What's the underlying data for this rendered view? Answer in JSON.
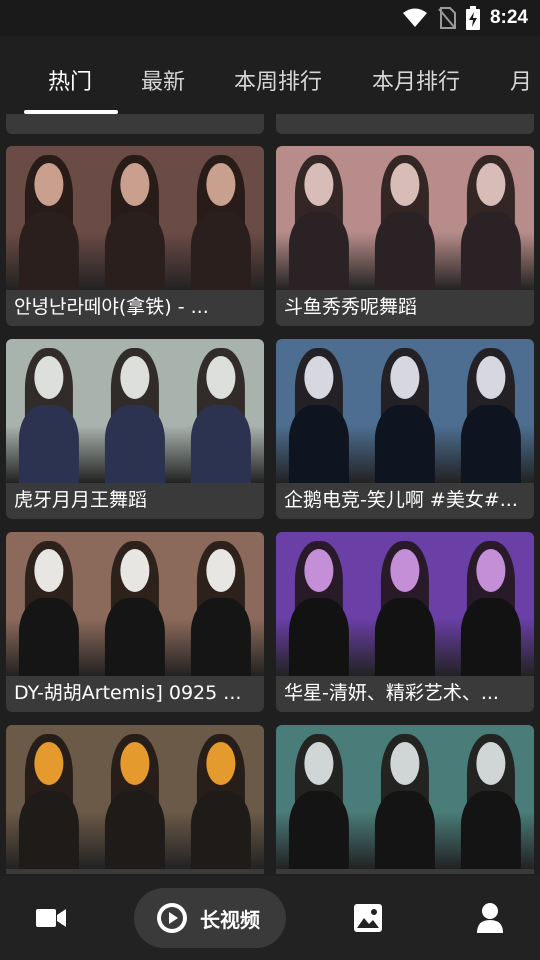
{
  "status": {
    "time": "8:24"
  },
  "tabs": [
    {
      "label": "热门",
      "active": true
    },
    {
      "label": "最新"
    },
    {
      "label": "本周排行"
    },
    {
      "label": "本月排行"
    },
    {
      "label": "月"
    }
  ],
  "cards": [
    {
      "title": "안녕난라떼야(拿铁) - ...",
      "colors": [
        "#6b4b45",
        "#c99f8e",
        "#2b1f1d"
      ]
    },
    {
      "title": "斗鱼秀秀呢舞蹈",
      "colors": [
        "#b78c8a",
        "#d8bcb7",
        "#2a2224"
      ]
    },
    {
      "title": "虎牙月月王舞蹈",
      "colors": [
        "#a9b3ae",
        "#dcdfdc",
        "#2b3350"
      ]
    },
    {
      "title": "企鹅电竞-笑儿啊 #美女#...",
      "colors": [
        "#4d6e91",
        "#d7d8df",
        "#0e1420"
      ]
    },
    {
      "title": "DY-胡胡Artemis] 0925 ...",
      "colors": [
        "#8c6a5b",
        "#e8e6e2",
        "#151515"
      ]
    },
    {
      "title": "华星-清妍、精彩艺术、...",
      "colors": [
        "#6a3fa6",
        "#c48fd6",
        "#121212"
      ]
    },
    {
      "title": "",
      "colors": [
        "#6b5a47",
        "#e59a2e",
        "#1e1b19"
      ]
    },
    {
      "title": "",
      "colors": [
        "#4a7d79",
        "#cfd6d5",
        "#141414"
      ]
    }
  ],
  "bottom_nav": {
    "video_icon": "video-camera-icon",
    "long_video_label": "长视频",
    "long_video_icon": "play-circle-icon",
    "gallery_icon": "image-icon",
    "profile_icon": "person-icon"
  }
}
